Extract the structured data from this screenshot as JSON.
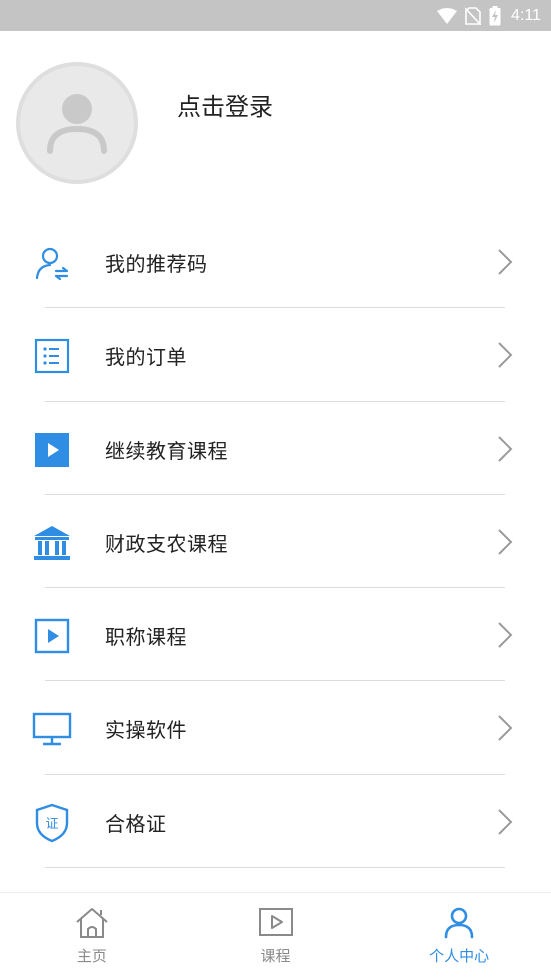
{
  "status_bar": {
    "time": "4:11",
    "icons": [
      "wifi-icon",
      "no-sim-icon",
      "battery-charging-icon"
    ]
  },
  "profile": {
    "avatar_icon": "user-avatar-icon",
    "login_label": "点击登录"
  },
  "menu": {
    "items": [
      {
        "label": "我的推荐码",
        "icon": "user-share-icon"
      },
      {
        "label": "我的订单",
        "icon": "list-icon"
      },
      {
        "label": "继续教育课程",
        "icon": "play-filled-icon"
      },
      {
        "label": "财政支农课程",
        "icon": "bank-icon"
      },
      {
        "label": "职称课程",
        "icon": "play-outline-icon"
      },
      {
        "label": "实操软件",
        "icon": "monitor-icon"
      },
      {
        "label": "合格证",
        "icon": "certificate-shield-icon"
      }
    ],
    "chevron_icon": "chevron-right-icon"
  },
  "tab_bar": {
    "tabs": [
      {
        "label": "主页",
        "icon": "home-icon",
        "active": false
      },
      {
        "label": "课程",
        "icon": "video-play-icon",
        "active": false
      },
      {
        "label": "个人中心",
        "icon": "person-icon",
        "active": true
      }
    ]
  },
  "colors": {
    "accent": "#2f8de4",
    "status_bar": "#c4c4c4",
    "text": "#222222",
    "muted": "#8a8a8a",
    "divider": "#dcdcdc"
  }
}
